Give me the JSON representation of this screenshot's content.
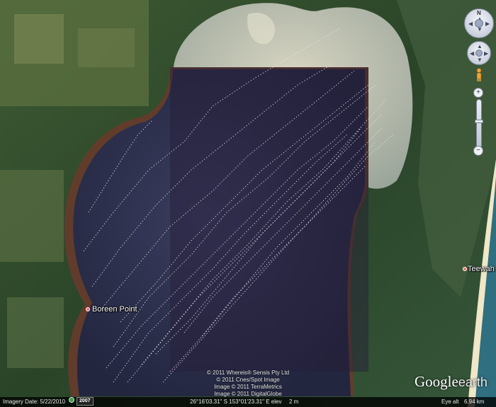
{
  "places": [
    {
      "id": "boreen-point",
      "label": "Boreen Point"
    },
    {
      "id": "teewah",
      "label": "Teewah"
    }
  ],
  "copyright_lines": [
    "© 2011 Whereis® Sensis Pty Ltd",
    "© 2011 Cnes/Spot Image",
    "Image © 2011 TerraMetrics",
    "Image © 2011 DigitalGlobe"
  ],
  "logo": {
    "brand": "Google",
    "product": "earth"
  },
  "status": {
    "imagery_date": "Imagery Date: 5/22/2010",
    "year": "2007",
    "coords": "26°16'03.31\" S 153°01'23.31\" E elev",
    "elev": "2 m",
    "eye_label": "Eye alt",
    "eye_value": "6.94 km"
  },
  "nav": {
    "north": "N",
    "zoom_in": "+",
    "zoom_out": "−",
    "zoom_level": 0.55
  },
  "colors": {
    "water": "#2d3150",
    "overlay": "#251d38",
    "sand": "#cfcdb7",
    "forest": "#2f4a2c",
    "track": "#e6e6ee",
    "beach": "#efe7c7",
    "ocean": "#2f6f7f",
    "marker": "#ff6a6a"
  }
}
